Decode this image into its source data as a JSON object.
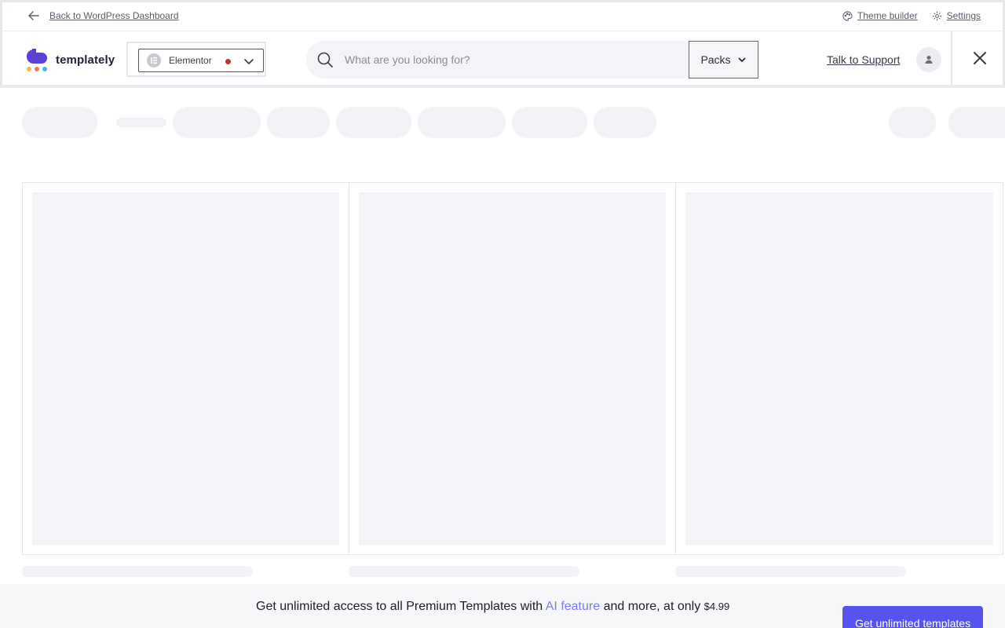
{
  "topbar": {
    "back_label": "Back to WordPress Dashboard",
    "theme_builder_label": "Theme builder",
    "settings_label": "Settings"
  },
  "header": {
    "logo_text": "templately",
    "builder": {
      "selected": "Elementor",
      "status_color": "#c23232"
    },
    "search": {
      "placeholder": "What are you looking for?",
      "value": ""
    },
    "filter": {
      "selected": "Packs"
    },
    "support_label": "Talk to Support"
  },
  "promo": {
    "text_before": "Get unlimited access to all Premium Templates with ",
    "highlight": "AI feature",
    "text_after": " and more, at only ",
    "price": "$4.99",
    "button_label": "Get unlimited templates"
  },
  "colors": {
    "accent": "#5753f0",
    "highlight": "#7a7cf0",
    "skeleton": "#f3f3f7"
  },
  "icons": [
    "arrow-left-icon",
    "palette-icon",
    "gear-icon",
    "logo-icon",
    "elementor-icon",
    "chevron-down-icon",
    "search-icon",
    "user-icon",
    "close-icon"
  ]
}
